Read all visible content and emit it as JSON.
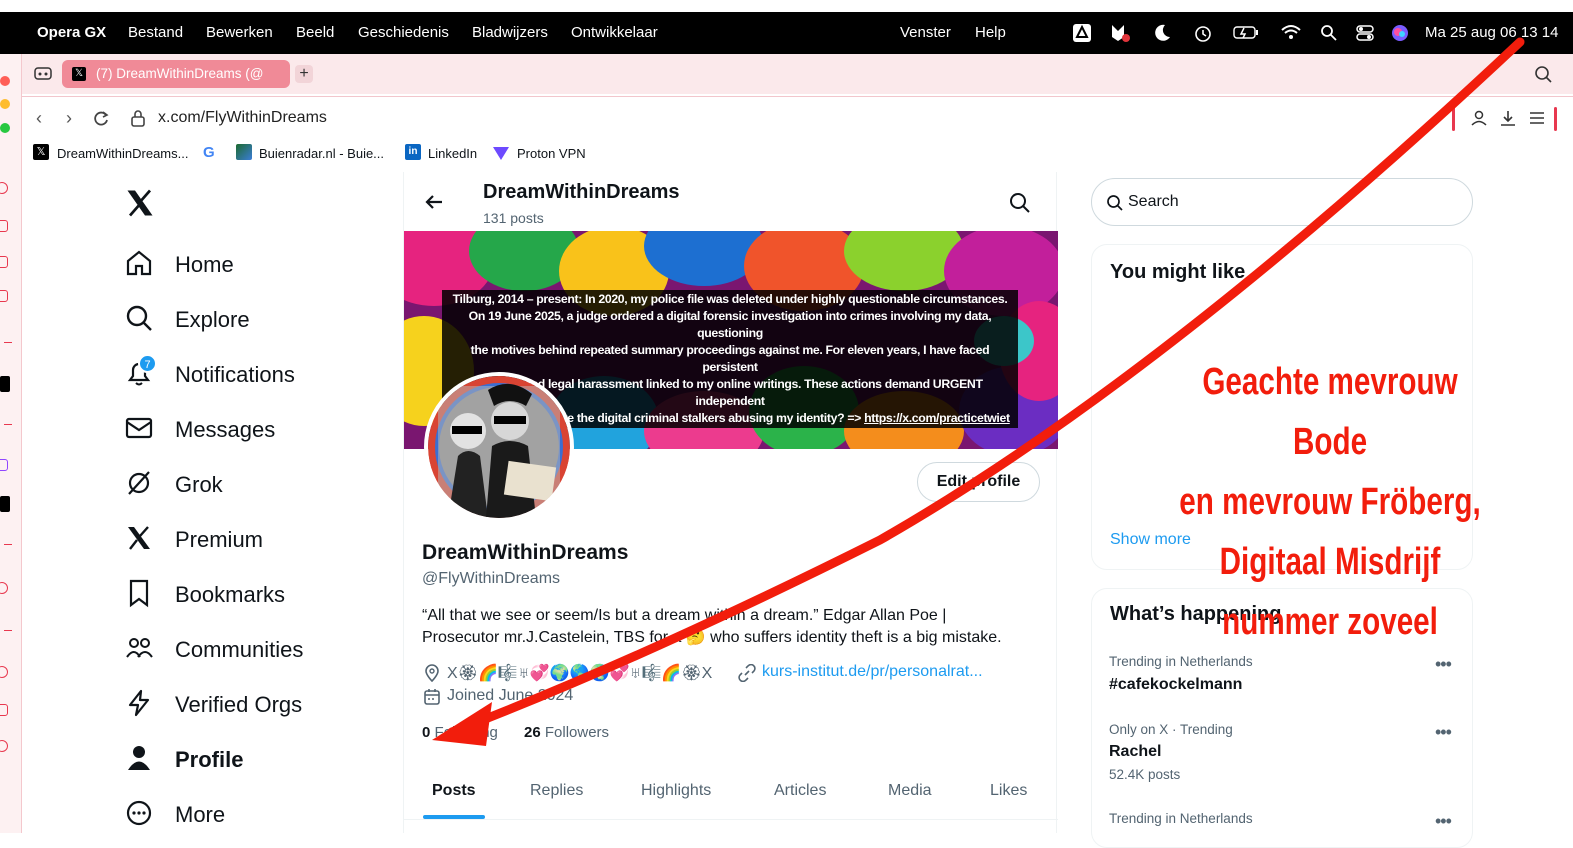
{
  "menubar": {
    "apple": "",
    "app": "Opera GX",
    "items": [
      "Bestand",
      "Bewerken",
      "Beeld",
      "Geschiedenis",
      "Bladwijzers",
      "Ontwikkelaar",
      "Venster",
      "Help"
    ],
    "clock": "Ma 25 aug  06 13 14"
  },
  "browser": {
    "tab_title": "(7) DreamWithinDreams (@",
    "new_tab": "+",
    "url": "x.com/FlyWithinDreams",
    "bookmarks": [
      "DreamWithinDreams...",
      "G",
      "Buienradar.nl - Buie...",
      "LinkedIn",
      "Proton VPN"
    ]
  },
  "nav": {
    "items": [
      "Home",
      "Explore",
      "Notifications",
      "Messages",
      "Grok",
      "Premium",
      "Bookmarks",
      "Communities",
      "Verified Orgs",
      "Profile",
      "More"
    ],
    "notif_count": "7"
  },
  "profile": {
    "header_name": "DreamWithinDreams",
    "post_count": "131 posts",
    "banner_lines": [
      "Tilburg, 2014 – present: In 2020, my police file was deleted under highly questionable circumstances.",
      "On 19 June 2025, a judge ordered a digital forensic investigation into crimes involving my data, questioning",
      "the motives behind repeated summary proceedings against me. For eleven years, I have faced persistent",
      "stalking and legal harassment linked to my online writings. These actions demand URGENT independent",
      "investigation. Who are the digital criminal stalkers abusing my identity? => "
    ],
    "banner_link": "https://x.com/practicetwiet",
    "edit_button": "Edit profile",
    "name": "DreamWithinDreams",
    "handle": "@FlyWithinDreams",
    "bio_line1": "“All that we see or seem/Is but a dream within a dream.” Edgar Allan Poe |",
    "bio_line2": "Prosecutor mr.J.Castelein, TBS for a 🤔 who suffers identity theft is a big mistake.",
    "location": "X🏵🌈🎼♅💞🌍🌎🌏💞♅🎼🌈🏵X",
    "link": "kurs-institut.de/pr/personalrat...",
    "joined": "Joined June 2024",
    "following_count": "0",
    "following_label": "Following",
    "followers_count": "26",
    "followers_label": "Followers",
    "tabs": [
      "Posts",
      "Replies",
      "Highlights",
      "Articles",
      "Media",
      "Likes"
    ]
  },
  "right": {
    "search_placeholder": "Search",
    "might_like_title": "You might like",
    "show_more": "Show more",
    "happening_title": "What’s happening",
    "trends": [
      {
        "meta": "Trending in Netherlands",
        "name": "#cafekockelmann",
        "posts": ""
      },
      {
        "meta": "Only on X · Trending",
        "name": "Rachel",
        "posts": "52.4K posts"
      },
      {
        "meta": "Trending in Netherlands",
        "name": "",
        "posts": ""
      }
    ]
  },
  "annotation": {
    "lines": [
      "Geachte mevrouw Bode",
      "en mevrouw Fröberg,",
      "Digitaal Misdrijf",
      "nummer zoveel"
    ],
    "color": "#f21d0c"
  },
  "colors": {
    "x_blue": "#1d9bf0",
    "opera_red": "#e8384f",
    "tab_pink": "#f08a97"
  }
}
